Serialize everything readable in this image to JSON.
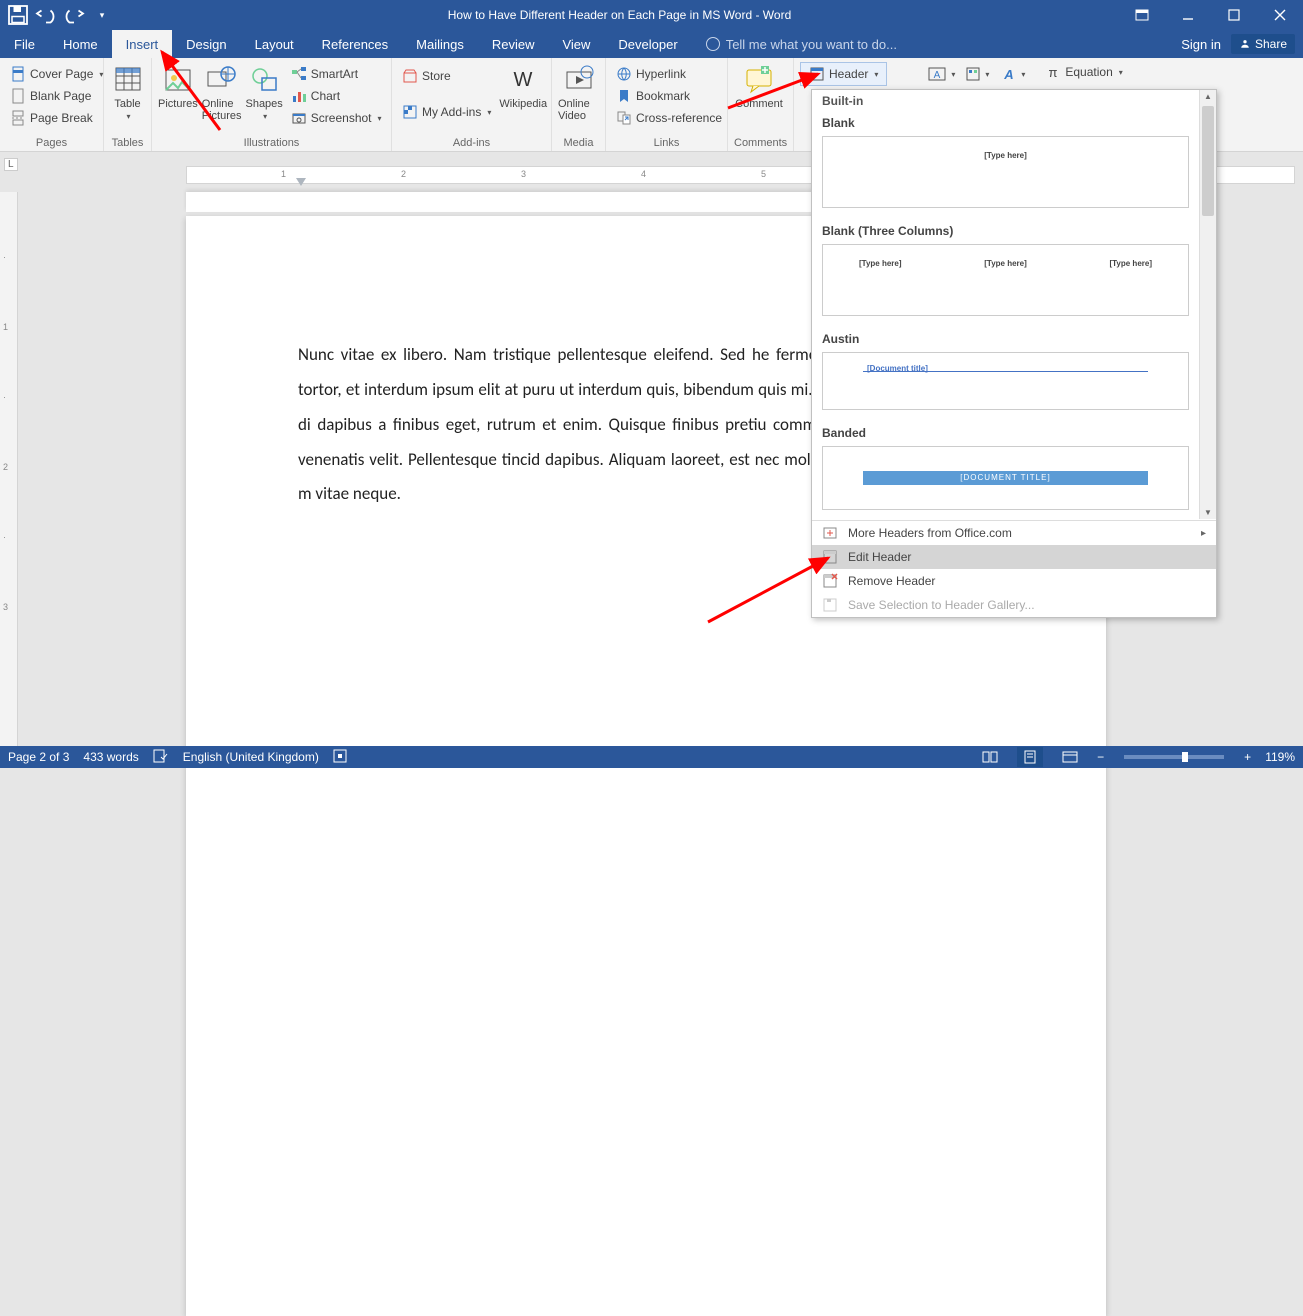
{
  "title": "How to Have Different Header on Each Page in MS Word - Word",
  "menu": {
    "file": "File",
    "home": "Home",
    "insert": "Insert",
    "design": "Design",
    "layout": "Layout",
    "references": "References",
    "mailings": "Mailings",
    "review": "Review",
    "view": "View",
    "developer": "Developer",
    "tell": "Tell me what you want to do...",
    "signin": "Sign in",
    "share": "Share"
  },
  "ribbon": {
    "pages": {
      "cover": "Cover Page",
      "blank": "Blank Page",
      "break": "Page Break",
      "label": "Pages"
    },
    "tables": {
      "table": "Table",
      "label": "Tables"
    },
    "illus": {
      "pictures": "Pictures",
      "online": "Online Pictures",
      "shapes": "Shapes",
      "smartart": "SmartArt",
      "chart": "Chart",
      "screenshot": "Screenshot",
      "label": "Illustrations"
    },
    "addins": {
      "store": "Store",
      "my": "My Add-ins",
      "wiki": "Wikipedia",
      "label": "Add-ins"
    },
    "media": {
      "video": "Online Video",
      "label": "Media"
    },
    "links": {
      "hyper": "Hyperlink",
      "book": "Bookmark",
      "cross": "Cross-reference",
      "label": "Links"
    },
    "comments": {
      "comment": "Comment",
      "label": "Comments"
    },
    "header": "Header",
    "equation": "Equation"
  },
  "gallery": {
    "builtin": "Built-in",
    "blank": "Blank",
    "blank_ph": "[Type here]",
    "blank3": "Blank (Three Columns)",
    "austin": "Austin",
    "austin_ph": "[Document title]",
    "banded": "Banded",
    "banded_ph": "[DOCUMENT TITLE]",
    "more": "More Headers from Office.com",
    "edit": "Edit Header",
    "remove": "Remove Header",
    "save": "Save Selection to Header Gallery..."
  },
  "body": "Nunc vitae ex libero. Nam tristique pellentesque eleifend. Sed he fermentum, mi neque convallis tortor, et interdum ipsum elit at puru ut interdum quis, bibendum quis mi. Duis id vestibulum orci, ac di dapibus a finibus eget, rutrum et enim. Quisque finibus pretiu commodo at ipsum id, pulvinar venenatis velit. Pellentesque tincid dapibus. Aliquam laoreet, est nec mollis imperdiet, elit ex cursus m vitae neque.",
  "status": {
    "page": "Page 2 of 3",
    "words": "433 words",
    "lang": "English (United Kingdom)",
    "zoom": "119%"
  },
  "ruler": {
    "L": "L",
    "t1": "1",
    "t2": "2",
    "t3": "3",
    "t4": "4",
    "t5": "5"
  }
}
